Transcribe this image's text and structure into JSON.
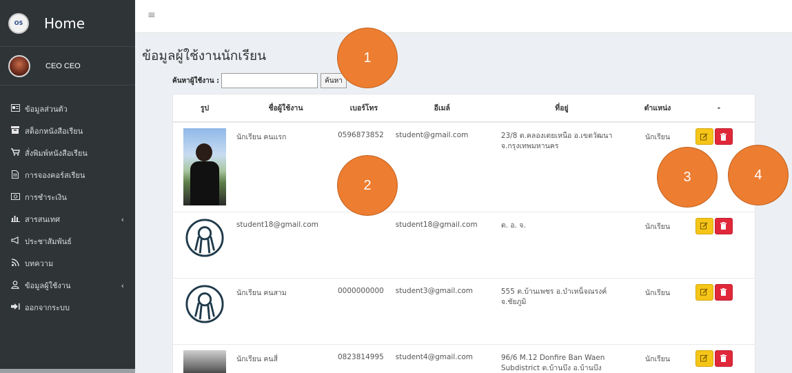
{
  "sidebar": {
    "brand_title": "Home",
    "brand_logo_text": "OS",
    "user_name": "CEO CEO",
    "items": [
      {
        "label": "ข้อมูลส่วนตัว",
        "icon": "id-card-icon"
      },
      {
        "label": "สต็อกหนังสือเรียน",
        "icon": "archive-icon"
      },
      {
        "label": "สั่งพิมพ์หนังสือเรียน",
        "icon": "cart-icon"
      },
      {
        "label": "การจองคอร์สเรียน",
        "icon": "file-icon"
      },
      {
        "label": "การชำระเงิน",
        "icon": "money-icon"
      },
      {
        "label": "สารสนเทศ",
        "icon": "bar-chart-icon"
      },
      {
        "label": "ประชาสัมพันธ์",
        "icon": "bullhorn-icon"
      },
      {
        "label": "บทความ",
        "icon": "rss-icon"
      },
      {
        "label": "ข้อมูลผู้ใช้งาน",
        "icon": "user-icon"
      },
      {
        "label": "ออกจากระบบ",
        "icon": "sign-out-icon"
      }
    ],
    "chevron": "‹"
  },
  "topbar": {
    "menu_icon": "≡"
  },
  "page": {
    "title": "ข้อมูลผู้ใช้งานนักเรียน"
  },
  "search": {
    "label": "ค้นหาผู้ใช้งาน :",
    "value": "",
    "button": "ค้นหา"
  },
  "table": {
    "headers": [
      "รูป",
      "ชื่อผู้ใช้งาน",
      "เบอร์โทร",
      "อีเมล์",
      "ที่อยู่",
      "ตำแหน่ง",
      "-"
    ],
    "rows": [
      {
        "name": "นักเรียน คนแรก",
        "phone": "0596873852",
        "email": "student@gmail.com",
        "address": "23/8 ต.คลองเตยเหนือ อ.เขตวัฒนา จ.กรุงเทพมหานคร",
        "position": "นักเรียน"
      },
      {
        "name": "student18@gmail.com",
        "phone": "",
        "email": "student18@gmail.com",
        "address": "ต. อ. จ.",
        "position": "นักเรียน"
      },
      {
        "name": "นักเรียน คนสาม",
        "phone": "0000000000",
        "email": "student3@gmail.com",
        "address": "555 ต.บ้านเพชร อ.บำเหน็จณรงค์ จ.ชัยภูมิ",
        "position": "นักเรียน"
      },
      {
        "name": "นักเรียน คนสี่",
        "phone": "0823814995",
        "email": "student4@gmail.com",
        "address": "96/6 M.12 Donfire Ban Waen Subdistrict ต.บ้านบึง อ.บ้านบึง",
        "position": "นักเรียน"
      }
    ]
  },
  "callouts": [
    "1",
    "2",
    "3",
    "4"
  ],
  "colors": {
    "sidebar": "#2f3437",
    "edit": "#f5c518",
    "delete": "#e0283a",
    "callout": "#ed7d31"
  }
}
